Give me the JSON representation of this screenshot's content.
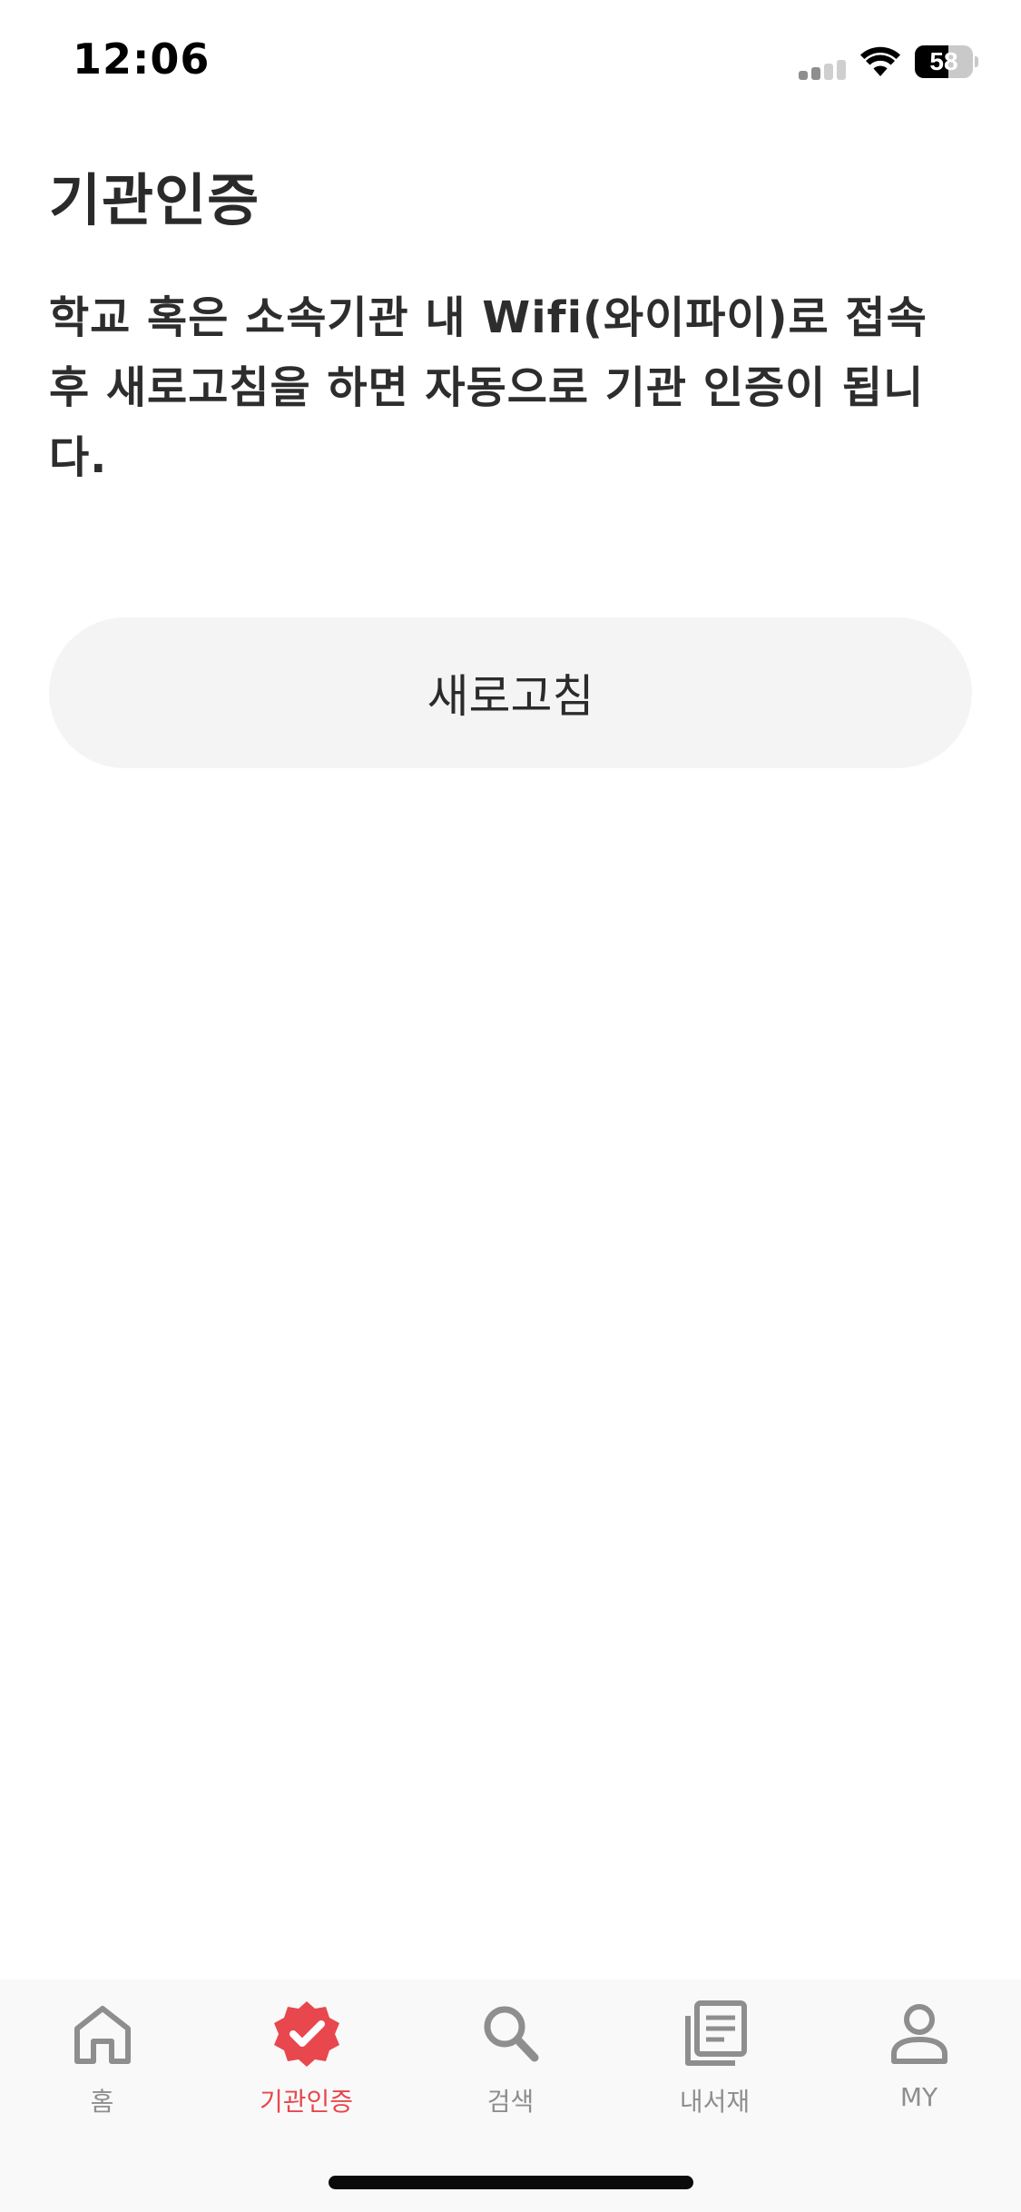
{
  "status_bar": {
    "time": "12:06",
    "battery_level": "58",
    "signal_icon": "cellular-signal-icon",
    "wifi_icon": "wifi-icon",
    "battery_icon": "battery-icon"
  },
  "header": {
    "title": "기관인증"
  },
  "main": {
    "instruction": "학교 혹은 소속기관 내 Wifi(와이파이)로 접속 후 새로고침을 하면 자동으로 기관 인증이 됩니다.",
    "refresh_button_label": "새로고침"
  },
  "tab_bar": {
    "active_color": "#e8474d",
    "inactive_color": "#8e8e8e",
    "items": [
      {
        "label": "홈",
        "icon": "home-icon",
        "active": false
      },
      {
        "label": "기관인증",
        "icon": "verified-badge-icon",
        "active": true
      },
      {
        "label": "검색",
        "icon": "search-icon",
        "active": false
      },
      {
        "label": "내서재",
        "icon": "library-icon",
        "active": false
      },
      {
        "label": "MY",
        "icon": "person-icon",
        "active": false
      }
    ]
  }
}
